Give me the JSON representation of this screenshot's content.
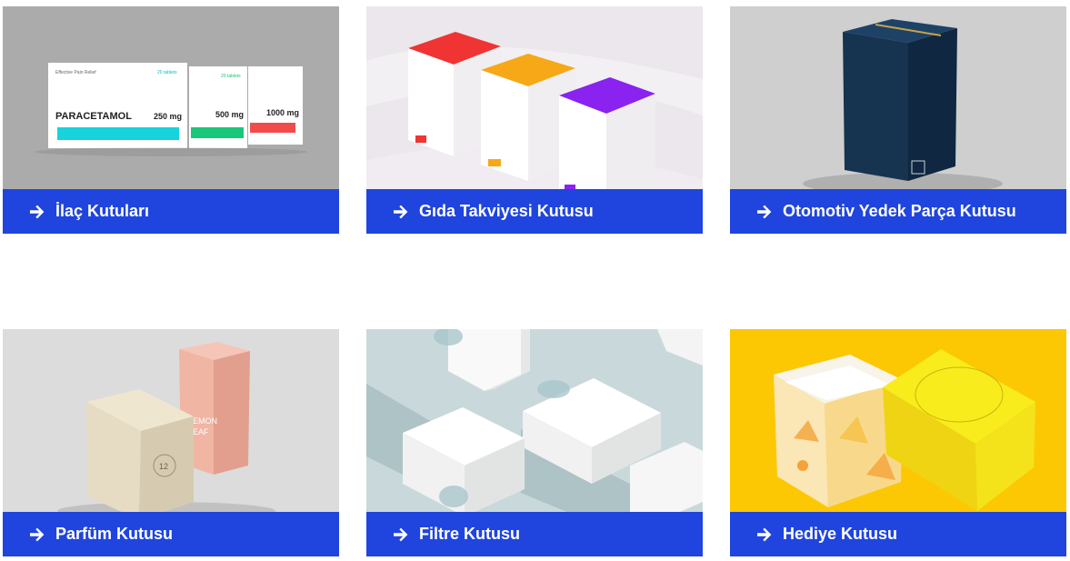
{
  "categories": [
    {
      "id": "ilac",
      "label": "İlaç Kutuları",
      "icon": "arrow-right-icon",
      "photo": {
        "box_texts": [
          "Effective Pain Relief",
          "20 tablets",
          "PARACETAMOL",
          "250 mg",
          "500 mg",
          "1000 mg"
        ],
        "colors": {
          "bg": "#a6a6a6",
          "accent1": "#17d3dc",
          "accent2": "#18c77a",
          "accent3": "#f04c4c"
        }
      }
    },
    {
      "id": "gida",
      "label": "Gıda Takviyesi Kutusu",
      "icon": "arrow-right-icon",
      "photo": {
        "colors": {
          "bg": "#ebe7ec",
          "red": "#f03434",
          "orange": "#f7a817",
          "purple": "#8a22f0"
        }
      }
    },
    {
      "id": "otomotiv",
      "label": "Otomotiv Yedek Parça Kutusu",
      "icon": "arrow-right-icon",
      "photo": {
        "colors": {
          "bg": "#cfcfcf",
          "box": "#163350"
        }
      }
    },
    {
      "id": "parfum",
      "label": "Parfüm Kutusu",
      "icon": "arrow-right-icon",
      "photo": {
        "box_texts": [
          "12",
          "LEMON",
          "LEAF"
        ],
        "colors": {
          "bg": "#dcdcdc",
          "cream": "#e6dcc4",
          "pink": "#f0b5a3"
        }
      }
    },
    {
      "id": "filtre",
      "label": "Filtre Kutusu",
      "icon": "arrow-right-icon",
      "photo": {
        "colors": {
          "bg": "#c9d9db",
          "box": "#f9f9f9"
        }
      }
    },
    {
      "id": "hediye",
      "label": "Hediye Kutusu",
      "icon": "arrow-right-icon",
      "photo": {
        "colors": {
          "bg": "#fcc804",
          "lid": "#f8ec1c"
        }
      }
    }
  ],
  "theme": {
    "caption_bg": "#1f45de",
    "caption_text": "#ffffff"
  }
}
